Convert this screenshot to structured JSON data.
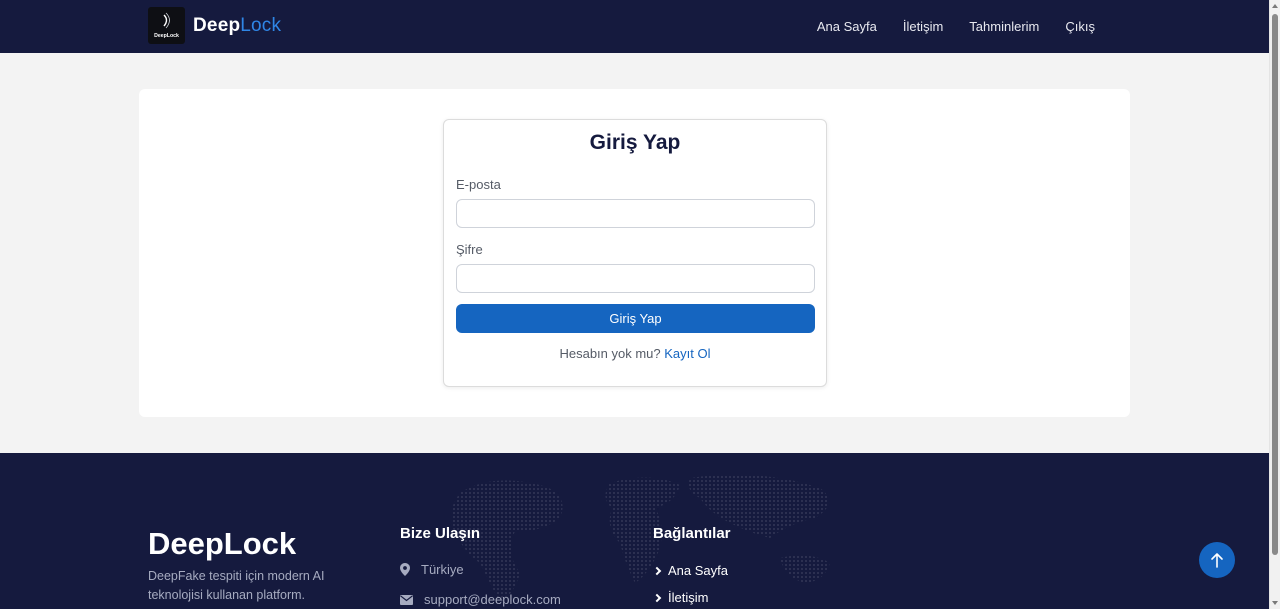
{
  "header": {
    "brand_main": "Deep",
    "brand_accent": "Lock",
    "logo_caption": "DeepLock",
    "nav": [
      {
        "label": "Ana Sayfa"
      },
      {
        "label": "İletişim"
      },
      {
        "label": "Tahminlerim"
      },
      {
        "label": "Çıkış"
      }
    ]
  },
  "login": {
    "title": "Giriş Yap",
    "email_label": "E-posta",
    "email_value": "",
    "password_label": "Şifre",
    "password_value": "",
    "submit_label": "Giriş Yap",
    "register_prompt": "Hesabın yok mu?",
    "register_link": "Kayıt Ol"
  },
  "footer": {
    "brand": "DeepLock",
    "description": "DeepFake tespiti için modern AI teknolojisi kullanan platform.",
    "contact_title": "Bize Ulaşın",
    "contact_location": "Türkiye",
    "contact_email": "support@deeplock.com",
    "links_title": "Bağlantılar",
    "links": [
      {
        "label": "Ana Sayfa"
      },
      {
        "label": "İletişim"
      }
    ]
  },
  "icons": {
    "location": "map-pin-icon",
    "email": "envelope-icon",
    "link_chevron": "chevron-right-icon",
    "back_to_top": "arrow-up-icon"
  },
  "colors": {
    "navy": "#151a3e",
    "accent_blue": "#1565c0",
    "brand_accent": "#2f86e6"
  }
}
